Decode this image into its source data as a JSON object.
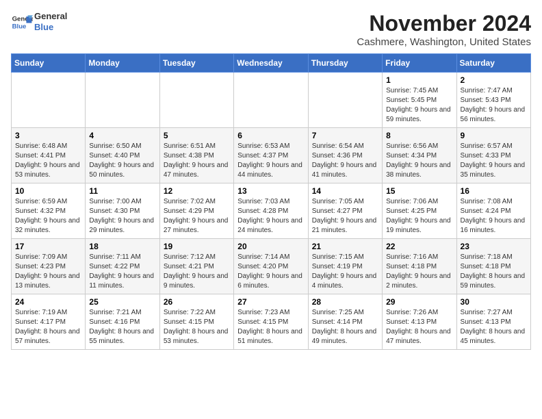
{
  "logo": {
    "line1": "General",
    "line2": "Blue"
  },
  "title": "November 2024",
  "location": "Cashmere, Washington, United States",
  "weekdays": [
    "Sunday",
    "Monday",
    "Tuesday",
    "Wednesday",
    "Thursday",
    "Friday",
    "Saturday"
  ],
  "weeks": [
    [
      {
        "day": "",
        "sunrise": "",
        "sunset": "",
        "daylight": ""
      },
      {
        "day": "",
        "sunrise": "",
        "sunset": "",
        "daylight": ""
      },
      {
        "day": "",
        "sunrise": "",
        "sunset": "",
        "daylight": ""
      },
      {
        "day": "",
        "sunrise": "",
        "sunset": "",
        "daylight": ""
      },
      {
        "day": "",
        "sunrise": "",
        "sunset": "",
        "daylight": ""
      },
      {
        "day": "1",
        "sunrise": "Sunrise: 7:45 AM",
        "sunset": "Sunset: 5:45 PM",
        "daylight": "Daylight: 9 hours and 59 minutes."
      },
      {
        "day": "2",
        "sunrise": "Sunrise: 7:47 AM",
        "sunset": "Sunset: 5:43 PM",
        "daylight": "Daylight: 9 hours and 56 minutes."
      }
    ],
    [
      {
        "day": "3",
        "sunrise": "Sunrise: 6:48 AM",
        "sunset": "Sunset: 4:41 PM",
        "daylight": "Daylight: 9 hours and 53 minutes."
      },
      {
        "day": "4",
        "sunrise": "Sunrise: 6:50 AM",
        "sunset": "Sunset: 4:40 PM",
        "daylight": "Daylight: 9 hours and 50 minutes."
      },
      {
        "day": "5",
        "sunrise": "Sunrise: 6:51 AM",
        "sunset": "Sunset: 4:38 PM",
        "daylight": "Daylight: 9 hours and 47 minutes."
      },
      {
        "day": "6",
        "sunrise": "Sunrise: 6:53 AM",
        "sunset": "Sunset: 4:37 PM",
        "daylight": "Daylight: 9 hours and 44 minutes."
      },
      {
        "day": "7",
        "sunrise": "Sunrise: 6:54 AM",
        "sunset": "Sunset: 4:36 PM",
        "daylight": "Daylight: 9 hours and 41 minutes."
      },
      {
        "day": "8",
        "sunrise": "Sunrise: 6:56 AM",
        "sunset": "Sunset: 4:34 PM",
        "daylight": "Daylight: 9 hours and 38 minutes."
      },
      {
        "day": "9",
        "sunrise": "Sunrise: 6:57 AM",
        "sunset": "Sunset: 4:33 PM",
        "daylight": "Daylight: 9 hours and 35 minutes."
      }
    ],
    [
      {
        "day": "10",
        "sunrise": "Sunrise: 6:59 AM",
        "sunset": "Sunset: 4:32 PM",
        "daylight": "Daylight: 9 hours and 32 minutes."
      },
      {
        "day": "11",
        "sunrise": "Sunrise: 7:00 AM",
        "sunset": "Sunset: 4:30 PM",
        "daylight": "Daylight: 9 hours and 29 minutes."
      },
      {
        "day": "12",
        "sunrise": "Sunrise: 7:02 AM",
        "sunset": "Sunset: 4:29 PM",
        "daylight": "Daylight: 9 hours and 27 minutes."
      },
      {
        "day": "13",
        "sunrise": "Sunrise: 7:03 AM",
        "sunset": "Sunset: 4:28 PM",
        "daylight": "Daylight: 9 hours and 24 minutes."
      },
      {
        "day": "14",
        "sunrise": "Sunrise: 7:05 AM",
        "sunset": "Sunset: 4:27 PM",
        "daylight": "Daylight: 9 hours and 21 minutes."
      },
      {
        "day": "15",
        "sunrise": "Sunrise: 7:06 AM",
        "sunset": "Sunset: 4:25 PM",
        "daylight": "Daylight: 9 hours and 19 minutes."
      },
      {
        "day": "16",
        "sunrise": "Sunrise: 7:08 AM",
        "sunset": "Sunset: 4:24 PM",
        "daylight": "Daylight: 9 hours and 16 minutes."
      }
    ],
    [
      {
        "day": "17",
        "sunrise": "Sunrise: 7:09 AM",
        "sunset": "Sunset: 4:23 PM",
        "daylight": "Daylight: 9 hours and 13 minutes."
      },
      {
        "day": "18",
        "sunrise": "Sunrise: 7:11 AM",
        "sunset": "Sunset: 4:22 PM",
        "daylight": "Daylight: 9 hours and 11 minutes."
      },
      {
        "day": "19",
        "sunrise": "Sunrise: 7:12 AM",
        "sunset": "Sunset: 4:21 PM",
        "daylight": "Daylight: 9 hours and 9 minutes."
      },
      {
        "day": "20",
        "sunrise": "Sunrise: 7:14 AM",
        "sunset": "Sunset: 4:20 PM",
        "daylight": "Daylight: 9 hours and 6 minutes."
      },
      {
        "day": "21",
        "sunrise": "Sunrise: 7:15 AM",
        "sunset": "Sunset: 4:19 PM",
        "daylight": "Daylight: 9 hours and 4 minutes."
      },
      {
        "day": "22",
        "sunrise": "Sunrise: 7:16 AM",
        "sunset": "Sunset: 4:18 PM",
        "daylight": "Daylight: 9 hours and 2 minutes."
      },
      {
        "day": "23",
        "sunrise": "Sunrise: 7:18 AM",
        "sunset": "Sunset: 4:18 PM",
        "daylight": "Daylight: 8 hours and 59 minutes."
      }
    ],
    [
      {
        "day": "24",
        "sunrise": "Sunrise: 7:19 AM",
        "sunset": "Sunset: 4:17 PM",
        "daylight": "Daylight: 8 hours and 57 minutes."
      },
      {
        "day": "25",
        "sunrise": "Sunrise: 7:21 AM",
        "sunset": "Sunset: 4:16 PM",
        "daylight": "Daylight: 8 hours and 55 minutes."
      },
      {
        "day": "26",
        "sunrise": "Sunrise: 7:22 AM",
        "sunset": "Sunset: 4:15 PM",
        "daylight": "Daylight: 8 hours and 53 minutes."
      },
      {
        "day": "27",
        "sunrise": "Sunrise: 7:23 AM",
        "sunset": "Sunset: 4:15 PM",
        "daylight": "Daylight: 8 hours and 51 minutes."
      },
      {
        "day": "28",
        "sunrise": "Sunrise: 7:25 AM",
        "sunset": "Sunset: 4:14 PM",
        "daylight": "Daylight: 8 hours and 49 minutes."
      },
      {
        "day": "29",
        "sunrise": "Sunrise: 7:26 AM",
        "sunset": "Sunset: 4:13 PM",
        "daylight": "Daylight: 8 hours and 47 minutes."
      },
      {
        "day": "30",
        "sunrise": "Sunrise: 7:27 AM",
        "sunset": "Sunset: 4:13 PM",
        "daylight": "Daylight: 8 hours and 45 minutes."
      }
    ]
  ]
}
